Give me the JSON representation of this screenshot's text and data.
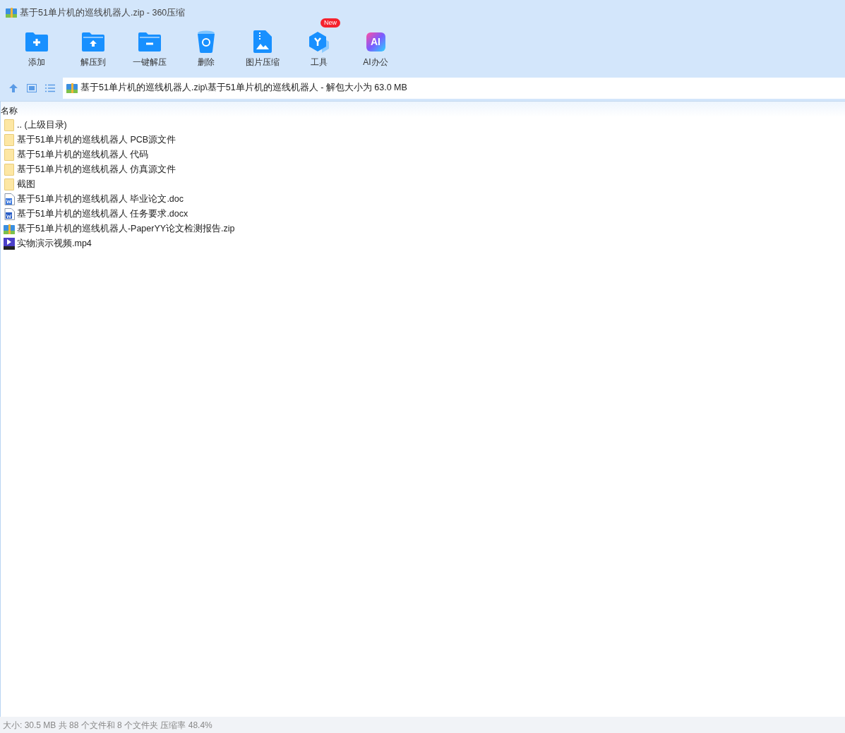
{
  "window": {
    "title": "基于51单片机的巡线机器人.zip - 360压缩"
  },
  "toolbar": [
    {
      "kind": "add",
      "label": "添加"
    },
    {
      "kind": "extract",
      "label": "解压到"
    },
    {
      "kind": "oneclick",
      "label": "一键解压"
    },
    {
      "kind": "delete",
      "label": "删除"
    },
    {
      "kind": "image",
      "label": "图片压缩"
    },
    {
      "kind": "tools",
      "label": "工具",
      "badge": "New"
    },
    {
      "kind": "ai",
      "label": "AI办公",
      "icon_text": "AI"
    }
  ],
  "path": "基于51单片机的巡线机器人.zip\\基于51单片机的巡线机器人 - 解包大小为 63.0 MB",
  "table": {
    "columns": [
      "名称"
    ],
    "rows": [
      {
        "kind": "folder",
        "name": ".. (上级目录)"
      },
      {
        "kind": "folder",
        "name": "基于51单片机的巡线机器人 PCB源文件"
      },
      {
        "kind": "folder",
        "name": "基于51单片机的巡线机器人 代码"
      },
      {
        "kind": "folder",
        "name": "基于51单片机的巡线机器人 仿真源文件"
      },
      {
        "kind": "folder",
        "name": "截图"
      },
      {
        "kind": "doc",
        "name": "基于51单片机的巡线机器人 毕业论文.doc"
      },
      {
        "kind": "docx",
        "name": "基于51单片机的巡线机器人 任务要求.docx"
      },
      {
        "kind": "zip",
        "name": "基于51单片机的巡线机器人-PaperYY论文检测报告.zip"
      },
      {
        "kind": "video",
        "name": "实物演示视频.mp4"
      }
    ]
  },
  "status_bar": "大小: 30.5 MB 共 88 个文件和 8 个文件夹 压缩率 48.4%"
}
